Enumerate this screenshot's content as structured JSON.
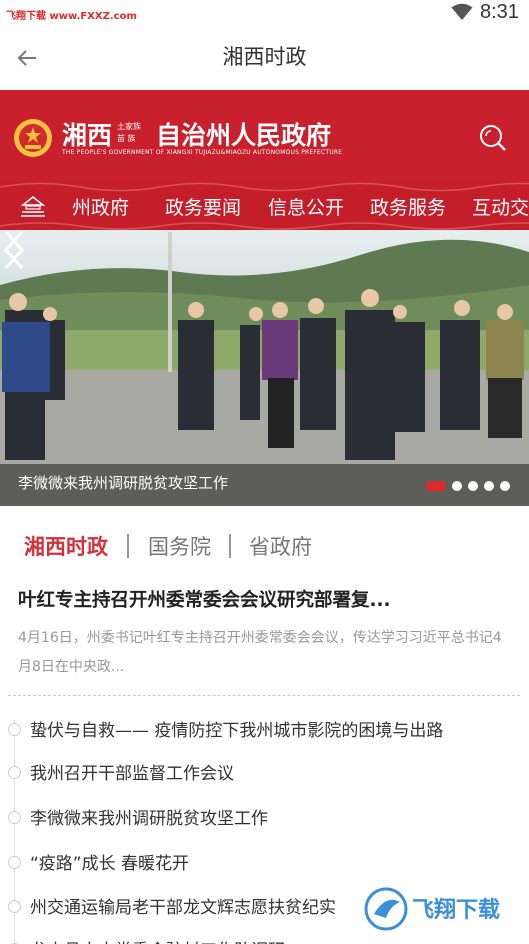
{
  "status_bar": {
    "watermark": "飞翔下载 www.FXXZ.com",
    "time": "8:31"
  },
  "appbar": {
    "title": "湘西时政"
  },
  "header": {
    "gov_name_left": "湘西",
    "gov_name_small_top": "土家族",
    "gov_name_small_bottom": "苗  族",
    "gov_name_right": "自治州人民政府",
    "gov_english": "THE PEOPLE'S GOVERNMENT OF XIANGXI TUJIAZU&MIAOZU AUTONOMOUS PREFECTURE",
    "nav": [
      "州政府",
      "政务要闻",
      "信息公开",
      "政务服务",
      "互动交流"
    ],
    "brand_red": "#c8202c"
  },
  "banner": {
    "caption": "李微微来我州调研脱贫攻坚工作",
    "slide_count": 5,
    "active_slide": 1
  },
  "tabs": {
    "items": [
      "湘西时政",
      "国务院",
      "省政府"
    ],
    "active": 0,
    "active_color": "#d3323a"
  },
  "featured": {
    "headline": "叶红专主持召开州委常委会会议研究部署复...",
    "summary": "4月16日，州委书记叶红专主持召开州委常委会会议，传达学习习近平总书记4月8日在中央政..."
  },
  "news": [
    "蛰伏与自救—— 疫情防控下我州城市影院的困境与出路",
    "我州召开干部监督工作会议",
    "李微微来我州调研脱贫攻坚工作",
    "“疫路”成长 春暖花开",
    "州交通运输局老干部龙文辉志愿扶贫纪实",
    "龙山县人大常委会驻村工作队调研"
  ],
  "watermark_bottom": "飞翔下载"
}
